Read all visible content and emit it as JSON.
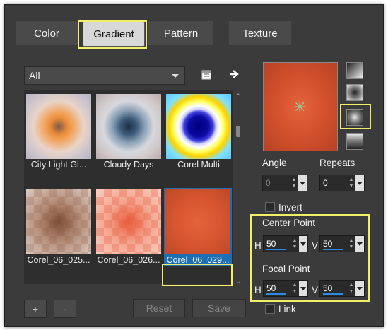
{
  "tabs": [
    {
      "label": "Color"
    },
    {
      "label": "Gradient"
    },
    {
      "label": "Pattern"
    },
    {
      "label": "Texture"
    }
  ],
  "filter": {
    "selected": "All"
  },
  "gallery": {
    "items": [
      {
        "caption": "City Light Gl..."
      },
      {
        "caption": "Cloudy Days"
      },
      {
        "caption": "Corel Multi"
      },
      {
        "caption": "Corel_06_025..."
      },
      {
        "caption": "Corel_06_026..."
      },
      {
        "caption": "Corel_06_029..."
      }
    ]
  },
  "angle": {
    "label": "Angle",
    "value": "0"
  },
  "repeats": {
    "label": "Repeats",
    "value": "0"
  },
  "invert": {
    "label": "Invert",
    "checked": false
  },
  "center_point": {
    "label": "Center Point",
    "h_label": "H",
    "h_value": "50",
    "v_label": "V",
    "v_value": "50"
  },
  "focal_point": {
    "label": "Focal Point",
    "h_label": "H",
    "h_value": "50",
    "v_label": "V",
    "v_value": "50"
  },
  "link": {
    "label": "Link",
    "checked": false
  },
  "buttons": {
    "add": "+",
    "remove": "-",
    "reset": "Reset",
    "save": "Save"
  },
  "colors": {
    "panel": "#3b3b3b",
    "highlight": "#f2ee6a",
    "selection": "#1c6fb3",
    "preview": "#d9552f"
  }
}
